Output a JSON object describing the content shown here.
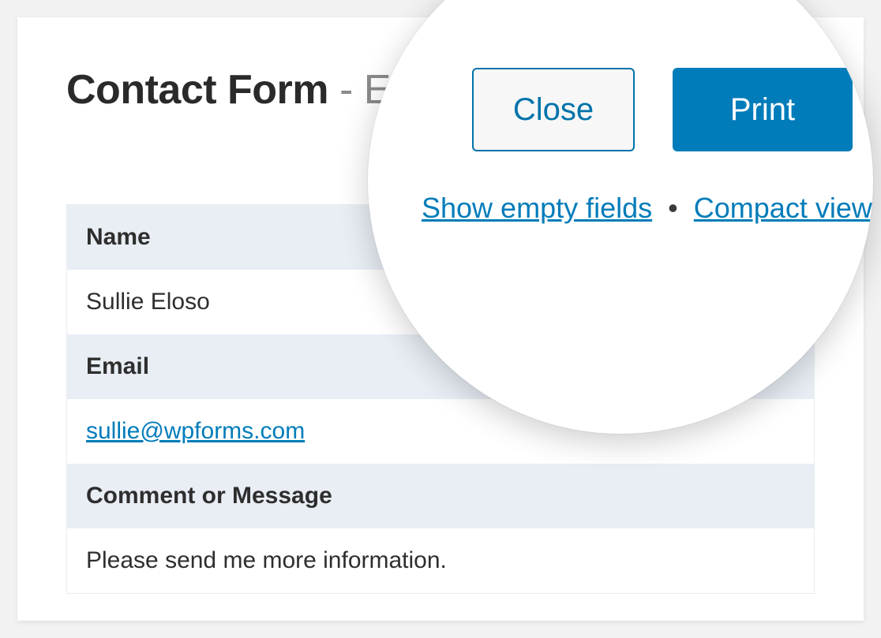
{
  "header": {
    "title_bold": "Contact Form",
    "title_rest": " - Entr"
  },
  "lens": {
    "close_label": "Close",
    "print_label": "Print",
    "show_empty_label": "Show empty fields",
    "separator": "•",
    "compact_view_label": "Compact view"
  },
  "entries": [
    {
      "label": "Name",
      "value": "Sullie Eloso",
      "is_link": false
    },
    {
      "label": "Email",
      "value": "sullie@wpforms.com",
      "is_link": true
    },
    {
      "label": "Comment or Message",
      "value": "Please send me more information.",
      "is_link": false
    }
  ]
}
